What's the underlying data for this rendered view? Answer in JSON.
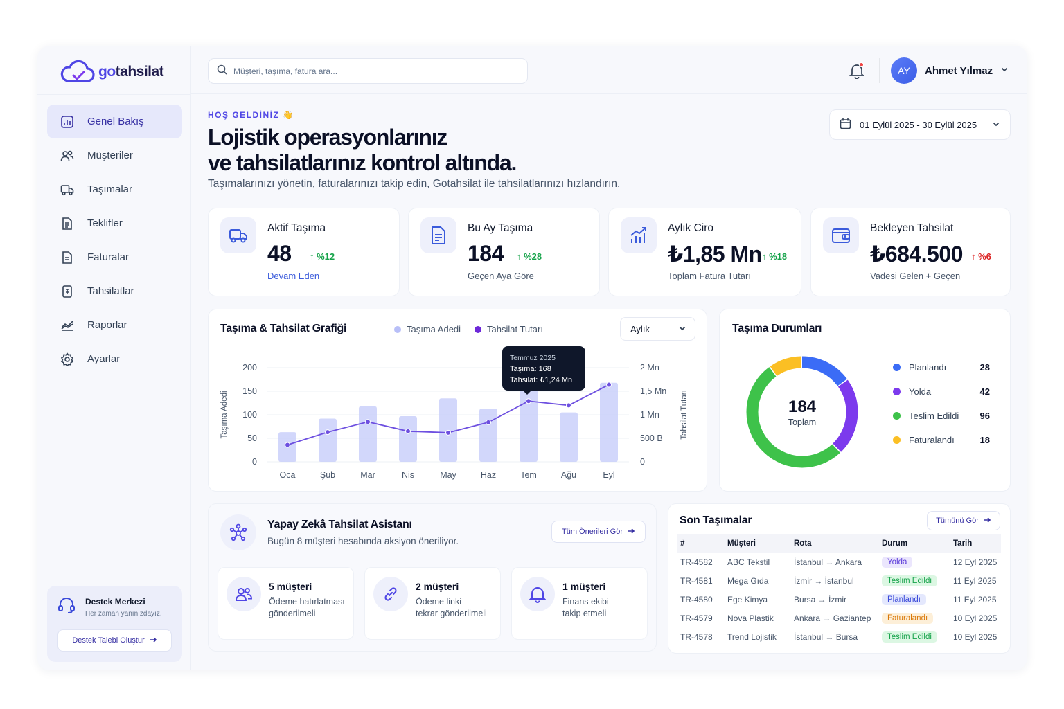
{
  "brand": {
    "logo_go": "go",
    "logo_rest": "tahsilat",
    "accent": "#4f46e5"
  },
  "sidebar": {
    "items": [
      {
        "label": "Genel Bakış",
        "icon": "dashboard-icon",
        "active": true
      },
      {
        "label": "Müşteriler",
        "icon": "users-icon"
      },
      {
        "label": "Taşımalar",
        "icon": "truck-icon"
      },
      {
        "label": "Teklifler",
        "icon": "document-list-icon"
      },
      {
        "label": "Faturalar",
        "icon": "invoice-icon"
      },
      {
        "label": "Tahsilatlar",
        "icon": "receipt-icon"
      },
      {
        "label": "Raporlar",
        "icon": "chart-line-icon"
      },
      {
        "label": "Ayarlar",
        "icon": "gear-icon"
      }
    ],
    "support": {
      "title": "Destek Merkezi",
      "subtitle": "Her zaman yanınızdayız.",
      "button": "Destek Talebi Oluştur"
    }
  },
  "topbar": {
    "search_placeholder": "Müşteri, taşıma, fatura ara...",
    "user_initials": "AY",
    "user_name": "Ahmet Yılmaz"
  },
  "hero": {
    "welcome": "HOŞ GELDİNİZ 👋",
    "headline_line1": "Lojistik operasyonlarınız",
    "headline_line2": "ve tahsilatlarınız kontrol altında.",
    "subline": "Taşımalarınızı yönetin, faturalarınızı takip edin, Gotahsilat ile tahsilatlarınızı hızlandırın.",
    "date_range": "01 Eylül 2025 - 30 Eylül 2025"
  },
  "stats": [
    {
      "title": "Aktif Taşıma",
      "value": "48",
      "delta": "%12",
      "direction": "up",
      "sub": "Devam Eden",
      "icon": "truck-icon"
    },
    {
      "title": "Bu Ay Taşıma",
      "value": "184",
      "delta": "%28",
      "direction": "up",
      "sub": "Geçen Aya Göre",
      "icon": "document-icon"
    },
    {
      "title": "Aylık Ciro",
      "value": "₺1,85 Mn",
      "delta": "%18",
      "direction": "up",
      "sub": "Toplam Fatura Tutarı",
      "icon": "bar-chart-up-icon"
    },
    {
      "title": "Bekleyen Tahsilat",
      "value": "₺684.500",
      "delta": "%6",
      "direction": "up-red",
      "sub": "Vadesi Gelen + Geçen",
      "icon": "wallet-icon"
    }
  ],
  "chart_panel": {
    "title": "Taşıma & Tahsilat Grafiği",
    "period": "Aylık",
    "tooltip": {
      "month": "Temmuz 2025",
      "line1": "Taşıma: 168",
      "line2": "Tahsilat: ₺1,24 Mn"
    }
  },
  "chart_data": {
    "type": "bar",
    "categories": [
      "Oca",
      "Şub",
      "Mar",
      "Nis",
      "May",
      "Haz",
      "Tem",
      "Ağu",
      "Eyl"
    ],
    "series": [
      {
        "name": "Taşıma Adedi",
        "type": "bar",
        "axis": "left",
        "color": "#c7cdfa",
        "values": [
          63,
          92,
          118,
          97,
          135,
          113,
          168,
          105,
          168
        ]
      },
      {
        "name": "Tahsilat Tutarı",
        "type": "line",
        "axis": "right",
        "color": "#6d4fe0",
        "values": [
          0.36,
          0.63,
          0.85,
          0.65,
          0.62,
          0.84,
          1.29,
          1.2,
          1.64
        ]
      }
    ],
    "ylabel": "Taşıma Adedi",
    "y2label": "Tahsilat Tutarı",
    "ylim": [
      0,
      200
    ],
    "y2lim": [
      0,
      2
    ],
    "yticks": [
      "0",
      "50",
      "100",
      "150",
      "200"
    ],
    "y2ticks": [
      "0",
      "500 B",
      "1 Mn",
      "1,5 Mn",
      "2 Mn"
    ],
    "grid": true,
    "legend": "top"
  },
  "status_panel": {
    "title": "Taşıma Durumları",
    "total": "184",
    "total_label": "Toplam",
    "items": [
      {
        "label": "Planlandı",
        "value": 28,
        "color": "#3b6cf6"
      },
      {
        "label": "Yolda",
        "value": 42,
        "color": "#7c3aed"
      },
      {
        "label": "Teslim Edildi",
        "value": 96,
        "color": "#3ec24a"
      },
      {
        "label": "Faturalandı",
        "value": 18,
        "color": "#fbbf24"
      }
    ]
  },
  "ai_panel": {
    "title": "Yapay Zekâ Tahsilat Asistanı",
    "subtitle": "Bugün 8 müşteri hesabında aksiyon öneriliyor.",
    "button": "Tüm Önerileri Gör",
    "cards": [
      {
        "title": "5 müşteri",
        "line1": "Ödeme hatırlatması",
        "line2": "gönderilmeli",
        "icon": "users-icon"
      },
      {
        "title": "2 müşteri",
        "line1": "Ödeme linki",
        "line2": "tekrar gönderilmeli",
        "icon": "link-icon"
      },
      {
        "title": "1 müşteri",
        "line1": "Finans ekibi",
        "line2": "takip etmeli",
        "icon": "bell-icon"
      }
    ]
  },
  "shipments": {
    "title": "Son Taşımalar",
    "button": "Tümünü Gör",
    "columns": [
      "#",
      "Müşteri",
      "Rota",
      "Durum",
      "Tarih"
    ],
    "rows": [
      {
        "id": "TR-4582",
        "customer": "ABC Tekstil",
        "route": "İstanbul → Ankara",
        "status": "Yolda",
        "status_type": "purple",
        "date": "12 Eyl 2025"
      },
      {
        "id": "TR-4581",
        "customer": "Mega Gıda",
        "route": "İzmir → İstanbul",
        "status": "Teslim Edildi",
        "status_type": "green",
        "date": "11 Eyl 2025"
      },
      {
        "id": "TR-4580",
        "customer": "Ege Kimya",
        "route": "Bursa → İzmir",
        "status": "Planlandı",
        "status_type": "blue",
        "date": "11 Eyl 2025"
      },
      {
        "id": "TR-4579",
        "customer": "Nova Plastik",
        "route": "Ankara → Gaziantep",
        "status": "Faturalandı",
        "status_type": "orange",
        "date": "10 Eyl 2025"
      },
      {
        "id": "TR-4578",
        "customer": "Trend Lojistik",
        "route": "İstanbul → Bursa",
        "status": "Teslim Edildi",
        "status_type": "green",
        "date": "10 Eyl 2025"
      }
    ]
  }
}
